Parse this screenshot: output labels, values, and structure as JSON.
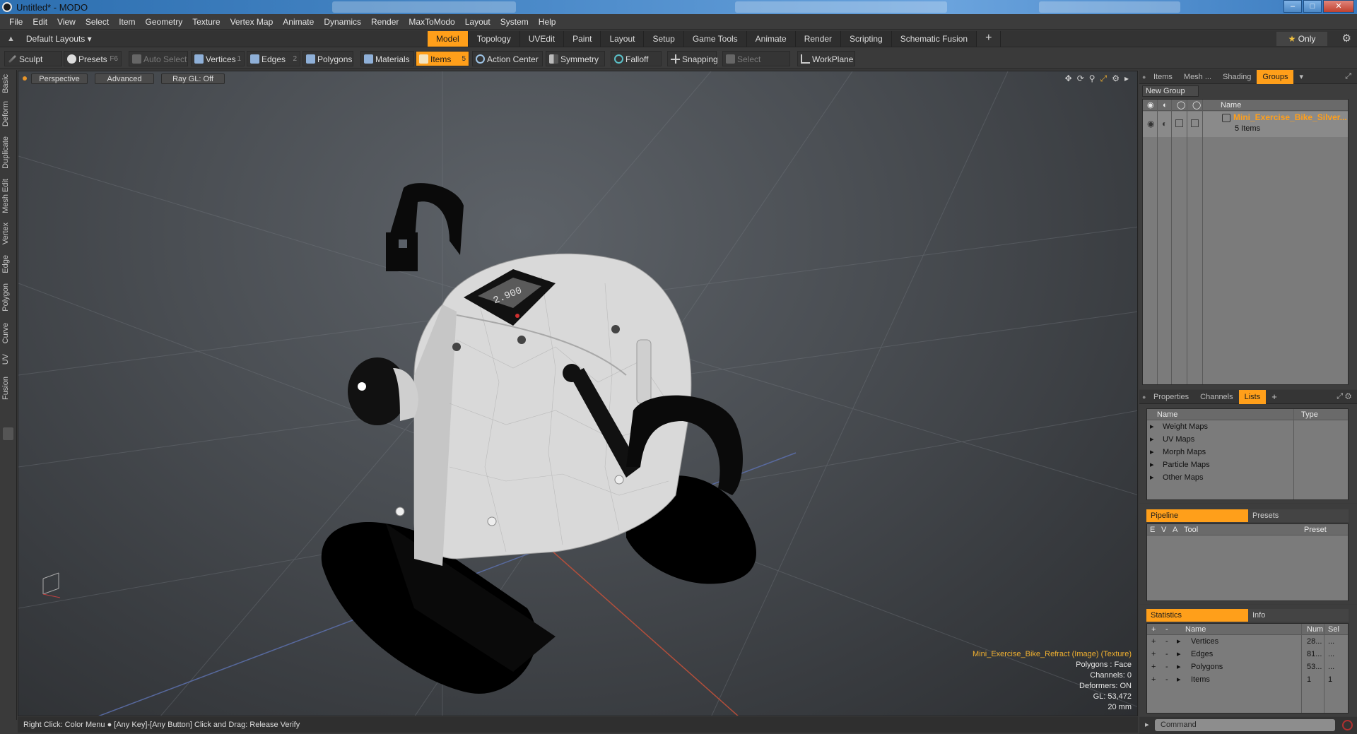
{
  "window": {
    "title": "Untitled* - MODO",
    "controls": [
      "minimize",
      "maximize",
      "close"
    ]
  },
  "menu": [
    "File",
    "Edit",
    "View",
    "Select",
    "Item",
    "Geometry",
    "Texture",
    "Vertex Map",
    "Animate",
    "Dynamics",
    "Render",
    "MaxToModo",
    "Layout",
    "System",
    "Help"
  ],
  "layoutbar": {
    "layout_select": "Default Layouts ▾",
    "tabs": [
      "Model",
      "Topology",
      "UVEdit",
      "Paint",
      "Layout",
      "Setup",
      "Game Tools",
      "Animate",
      "Render",
      "Scripting",
      "Schematic Fusion"
    ],
    "active_tab": "Model",
    "plus": "+",
    "only_label": "Only"
  },
  "toolbar": {
    "sculpt": "Sculpt",
    "presets": "Presets",
    "presets_key": "F6",
    "auto_select": "Auto Select",
    "vertices": "Vertices",
    "vertices_key": "1",
    "edges": "Edges",
    "edges_key": "2",
    "polygons": "Polygons",
    "materials": "Materials",
    "items": "Items",
    "items_key": "5",
    "action_center": "Action Center",
    "symmetry": "Symmetry",
    "falloff": "Falloff",
    "snapping": "Snapping",
    "select_through": "Select Through",
    "workplane": "WorkPlane"
  },
  "left_tabs": [
    "Basic",
    "Deform",
    "Duplicate",
    "Mesh Edit",
    "Vertex",
    "Edge",
    "Polygon",
    "Curve",
    "UV",
    "Fusion"
  ],
  "viewport": {
    "view_mode": "Perspective",
    "shading": "Advanced",
    "raygl": "Ray GL: Off",
    "info": {
      "texture": "Mini_Exercise_Bike_Refract (Image) (Texture)",
      "polygons": "Polygons : Face",
      "channels": "Channels: 0",
      "deformers": "Deformers: ON",
      "gl": "GL: 53,472",
      "scale": "20 mm"
    },
    "display_label": "2.900"
  },
  "status": {
    "text": "Right Click: Color Menu ● [Any Key]-[Any Button] Click and Drag: Release Verify"
  },
  "groups_panel": {
    "tabs": [
      "Items",
      "Mesh ...",
      "Shading",
      "Groups"
    ],
    "active_tab": "Groups",
    "new_group": "New Group",
    "col_name": "Name",
    "group_name": "Mini_Exercise_Bike_Silver...",
    "group_count": "5 Items"
  },
  "lists_panel": {
    "tabs": [
      "Properties",
      "Channels",
      "Lists"
    ],
    "active_tab": "Lists",
    "plus": "+",
    "col_name": "Name",
    "col_type": "Type",
    "rows": [
      "Weight Maps",
      "UV Maps",
      "Morph Maps",
      "Particle Maps",
      "Other Maps"
    ]
  },
  "pipeline_panel": {
    "tabs": [
      "Pipeline",
      "Presets"
    ],
    "active_tab": "Pipeline",
    "cols": [
      "E",
      "V",
      "A",
      "Tool",
      "Preset"
    ]
  },
  "stats_panel": {
    "tabs": [
      "Statistics",
      "Info"
    ],
    "active_tab": "Statistics",
    "head_plus": "+",
    "head_minus": "-",
    "col_name": "Name",
    "col_num": "Num",
    "col_sel": "Sel",
    "rows": [
      {
        "name": "Vertices",
        "num": "28...",
        "sel": "..."
      },
      {
        "name": "Edges",
        "num": "81...",
        "sel": "..."
      },
      {
        "name": "Polygons",
        "num": "53...",
        "sel": "..."
      },
      {
        "name": "Items",
        "num": "1",
        "sel": "1"
      }
    ]
  },
  "command": {
    "placeholder": "Command"
  },
  "colors": {
    "accent": "#ff9f1a",
    "panel": "#3d3d3d",
    "list_bg": "#7b7b7b"
  }
}
